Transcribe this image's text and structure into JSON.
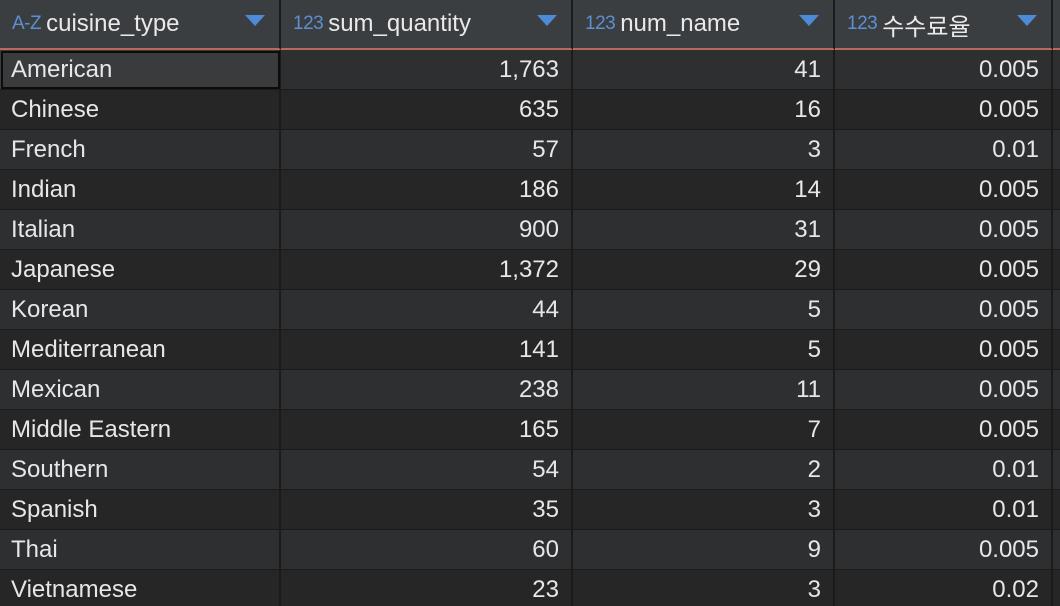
{
  "table": {
    "columns": [
      {
        "type_badge": "A-Z",
        "name": "cuisine_type"
      },
      {
        "type_badge": "123",
        "name": "sum_quantity"
      },
      {
        "type_badge": "123",
        "name": "num_name"
      },
      {
        "type_badge": "123",
        "name": "수수료율"
      }
    ],
    "rows": [
      [
        "American",
        "1,763",
        "41",
        "0.005"
      ],
      [
        "Chinese",
        "635",
        "16",
        "0.005"
      ],
      [
        "French",
        "57",
        "3",
        "0.01"
      ],
      [
        "Indian",
        "186",
        "14",
        "0.005"
      ],
      [
        "Italian",
        "900",
        "31",
        "0.005"
      ],
      [
        "Japanese",
        "1,372",
        "29",
        "0.005"
      ],
      [
        "Korean",
        "44",
        "5",
        "0.005"
      ],
      [
        "Mediterranean",
        "141",
        "5",
        "0.005"
      ],
      [
        "Mexican",
        "238",
        "11",
        "0.005"
      ],
      [
        "Middle Eastern",
        "165",
        "7",
        "0.005"
      ],
      [
        "Southern",
        "54",
        "2",
        "0.01"
      ],
      [
        "Spanish",
        "35",
        "3",
        "0.01"
      ],
      [
        "Thai",
        "60",
        "9",
        "0.005"
      ],
      [
        "Vietnamese",
        "23",
        "3",
        "0.02"
      ]
    ]
  },
  "colors": {
    "header_bg": "#3b3e41",
    "type_badge": "#5d8fd1",
    "sort_arrow": "#4d8ad8",
    "header_underline": "#b96a5a",
    "row_odd": "#2e2f30",
    "row_even": "#262627"
  }
}
